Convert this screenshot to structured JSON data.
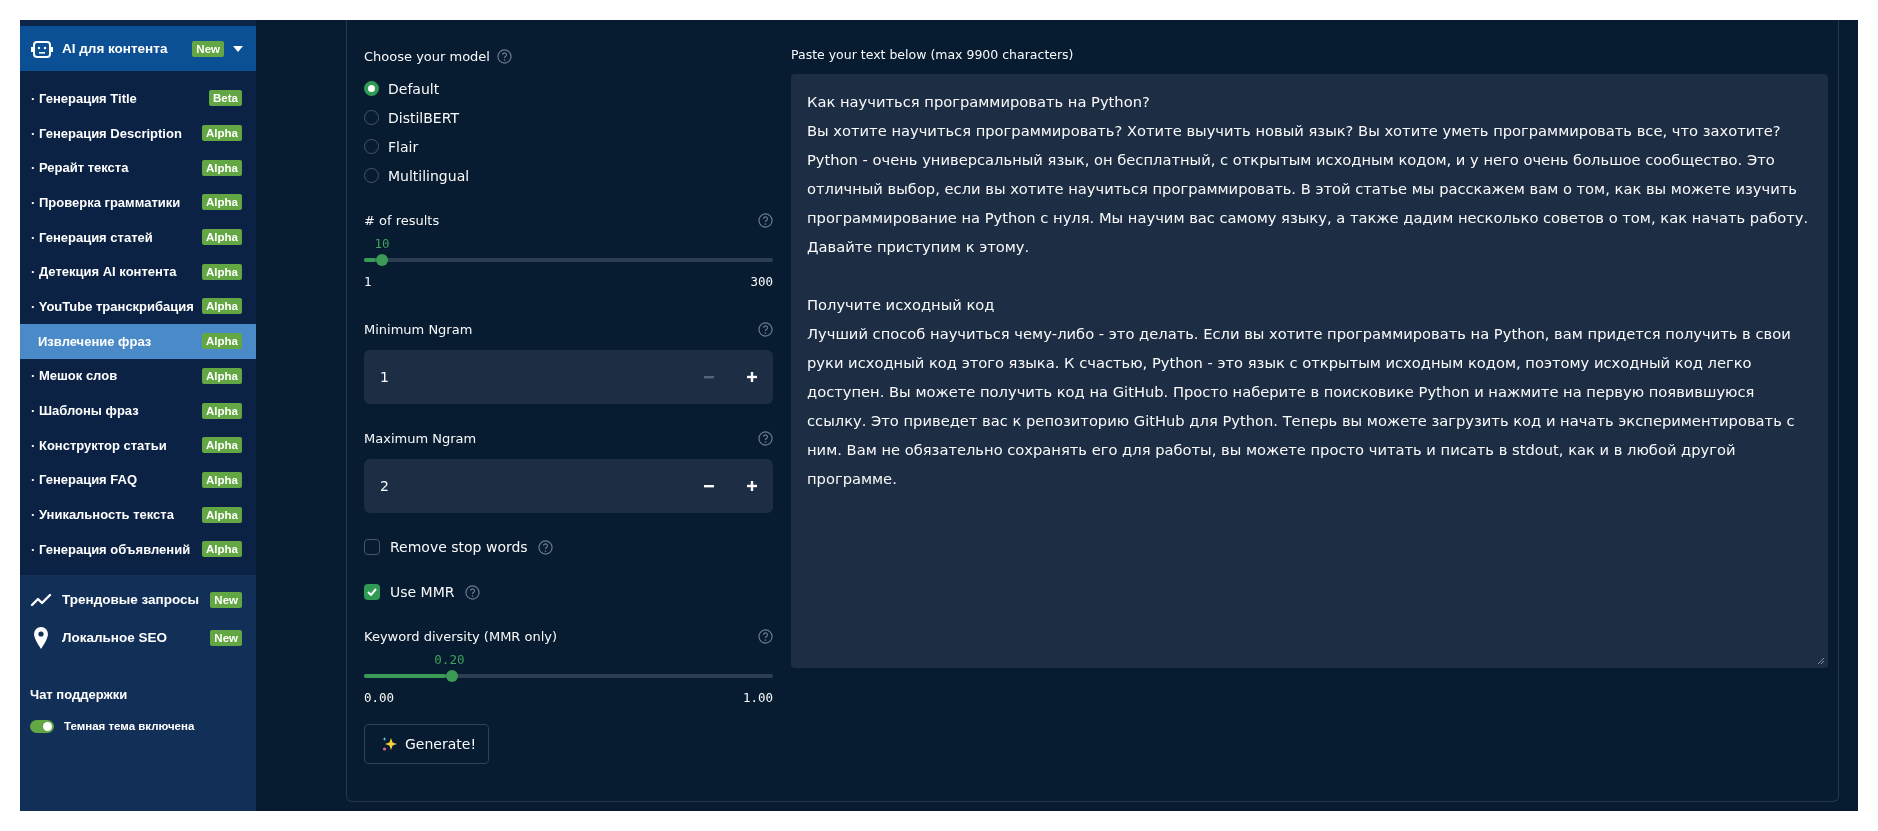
{
  "sidebar": {
    "header": {
      "label": "AI для контента",
      "badge": "New",
      "expanded": true
    },
    "items": [
      {
        "label": "· Генерация Title",
        "badge": "Beta",
        "selected": false
      },
      {
        "label": "· Генерация Description",
        "badge": "Alpha",
        "selected": false
      },
      {
        "label": "· Рерайт текста",
        "badge": "Alpha",
        "selected": false
      },
      {
        "label": "· Проверка грамматики",
        "badge": "Alpha",
        "selected": false
      },
      {
        "label": "· Генерация статей",
        "badge": "Alpha",
        "selected": false
      },
      {
        "label": "· Детекция AI контента",
        "badge": "Alpha",
        "selected": false
      },
      {
        "label": "· YouTube транскрибация",
        "badge": "Alpha",
        "selected": false
      },
      {
        "label": "Извлечение фраз",
        "badge": "Alpha",
        "selected": true
      },
      {
        "label": "· Мешок слов",
        "badge": "Alpha",
        "selected": false
      },
      {
        "label": "· Шаблоны фраз",
        "badge": "Alpha",
        "selected": false
      },
      {
        "label": "· Конструктор статьи",
        "badge": "Alpha",
        "selected": false
      },
      {
        "label": "· Генерация FAQ",
        "badge": "Alpha",
        "selected": false
      },
      {
        "label": "· Уникальность текста",
        "badge": "Alpha",
        "selected": false
      },
      {
        "label": "· Генерация объявлений",
        "badge": "Alpha",
        "selected": false
      }
    ],
    "sections": [
      {
        "kind": "trend",
        "label": "Трендовые запросы",
        "badge": "New"
      },
      {
        "kind": "pin",
        "label": "Локальное SEO",
        "badge": "New"
      }
    ],
    "support_title": "Чат поддержки",
    "theme_toggle": {
      "label": "Темная тема включена",
      "on": true
    }
  },
  "controls": {
    "model": {
      "label": "Choose your model",
      "options": [
        {
          "label": "Default",
          "selected": true
        },
        {
          "label": "DistilBERT",
          "selected": false
        },
        {
          "label": "Flair",
          "selected": false
        },
        {
          "label": "Multilingual",
          "selected": false
        }
      ]
    },
    "results": {
      "label": "# of results",
      "value": "10",
      "min": "1",
      "max": "300",
      "level": 0.03
    },
    "min_ngram": {
      "label": "Minimum Ngram",
      "value": "1",
      "minus_disabled": true
    },
    "max_ngram": {
      "label": "Maximum Ngram",
      "value": "2",
      "minus_disabled": false
    },
    "checkboxes": [
      {
        "label": "Remove stop words",
        "checked": false
      },
      {
        "label": "Use MMR",
        "checked": true
      }
    ],
    "diversity": {
      "label": "Keyword diversity (MMR only)",
      "value": "0.20",
      "min": "0.00",
      "max": "1.00",
      "level": 0.2
    },
    "generate_button": "Generate!"
  },
  "text_input": {
    "label": "Paste your text below (max 9900 characters)",
    "value": "Как научиться программировать на Python?\nВы хотите научиться программировать? Хотите выучить новый язык? Вы хотите уметь программировать все, что захотите? Python - очень универсальный язык, он бесплатный, с открытым исходным кодом, и у него очень большое сообщество. Это отличный выбор, если вы хотите научиться программировать. В этой статье мы расскажем вам о том, как вы можете изучить программирование на Python с нуля. Мы научим вас самому языку, а также дадим несколько советов о том, как начать работу. Давайте приступим к этому.\n\nПолучите исходный код\nЛучший способ научиться чему-либо - это делать. Если вы хотите программировать на Python, вам придется получить в свои руки исходный код этого языка. К счастью, Python - это язык с открытым исходным кодом, поэтому исходный код легко доступен. Вы можете получить код на GitHub. Просто наберите в поисковике Python и нажмите на первую появившуюся ссылку. Это приведет вас к репозиторию GitHub для Python. Теперь вы можете загрузить код и начать экспериментировать с ним. Вам не обязательно сохранять его для работы, вы можете просто читать и писать в stdout, как и в любой другой программе."
  }
}
